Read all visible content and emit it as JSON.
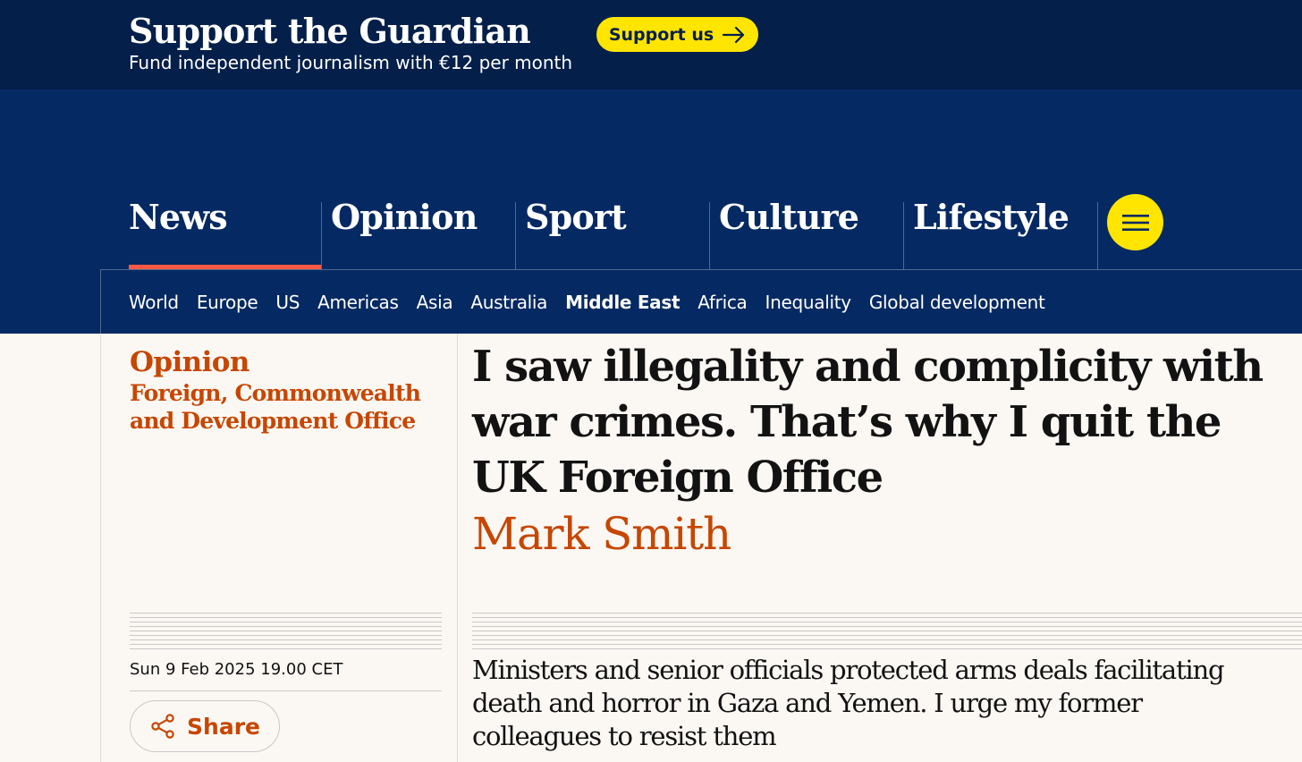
{
  "support_banner": {
    "title": "Support the Guardian",
    "subtitle": "Fund independent journalism with €12 per month",
    "button_label": "Support us"
  },
  "nav": {
    "pillars": [
      {
        "label": "News",
        "active": true
      },
      {
        "label": "Opinion",
        "active": false
      },
      {
        "label": "Sport",
        "active": false
      },
      {
        "label": "Culture",
        "active": false
      },
      {
        "label": "Lifestyle",
        "active": false
      }
    ],
    "menu_icon": "hamburger-icon",
    "subnav": [
      {
        "label": "World",
        "active": false
      },
      {
        "label": "Europe",
        "active": false
      },
      {
        "label": "US",
        "active": false
      },
      {
        "label": "Americas",
        "active": false
      },
      {
        "label": "Asia",
        "active": false
      },
      {
        "label": "Australia",
        "active": false
      },
      {
        "label": "Middle East",
        "active": true
      },
      {
        "label": "Africa",
        "active": false
      },
      {
        "label": "Inequality",
        "active": false
      },
      {
        "label": "Global development",
        "active": false
      }
    ]
  },
  "article": {
    "kicker": "Opinion",
    "series": "Foreign, Commonwealth and Development Office",
    "headline": "I saw illegality and complicity with war crimes. That’s why I quit the UK Foreign Office",
    "byline": "Mark Smith",
    "date": "Sun 9 Feb 2025 19.00 CET",
    "share_label": "Share",
    "share_icon": "share-icon",
    "standfirst": "Ministers and senior officials protected arms deals facilitating death and horror in Gaza and Yemen. I urge my former colleagues to resist them"
  },
  "colors": {
    "support_bg": "#041f4a",
    "nav_bg": "#052962",
    "accent_yellow": "#ffe500",
    "active_pillar_red": "#ff5943",
    "opinion_orange": "#c74600",
    "page_bg": "#fbf8f4"
  }
}
